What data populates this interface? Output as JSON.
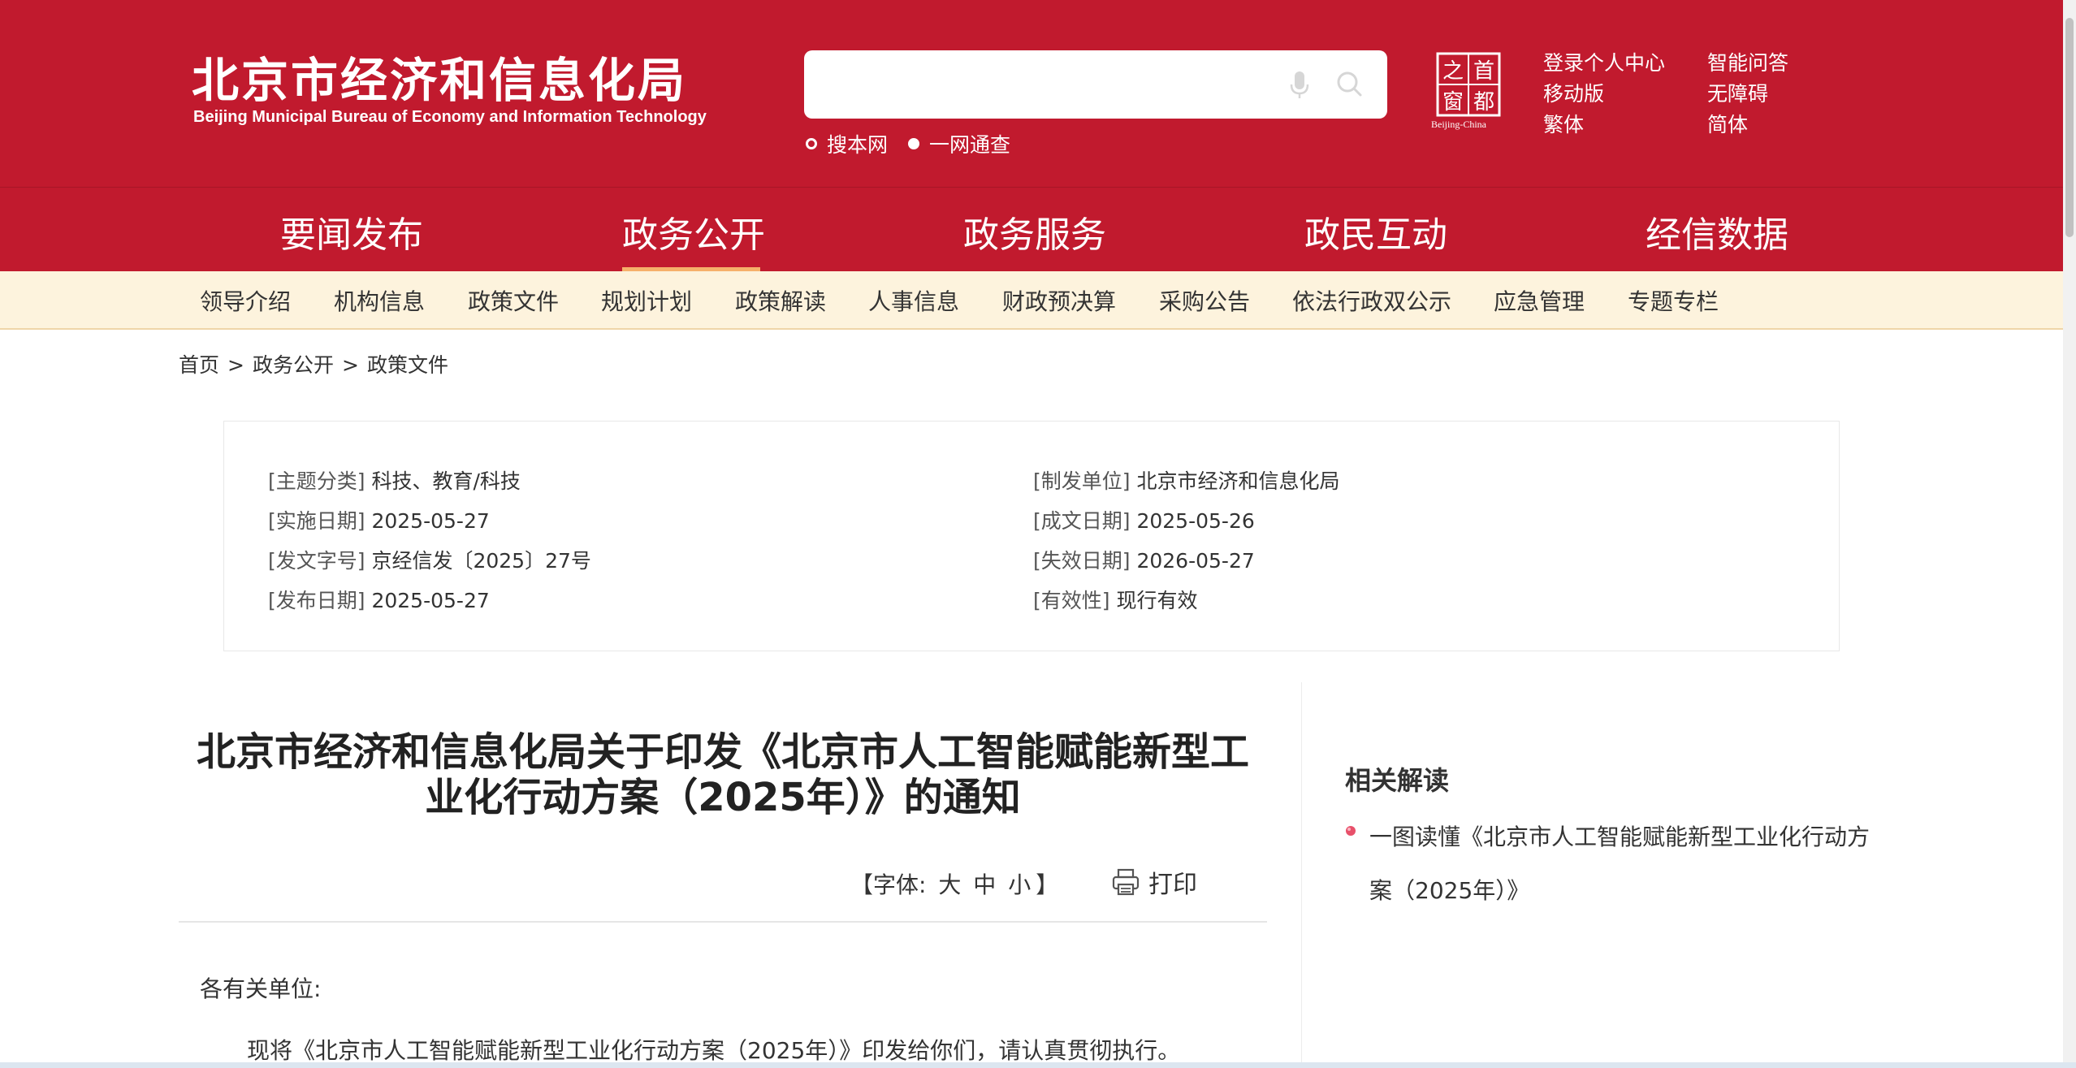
{
  "header": {
    "logo_cn": "北京市经济和信息化局",
    "logo_en": "Beijing Municipal Bureau of Economy and Information Technology",
    "search": {
      "placeholder": ""
    },
    "scope_options": [
      "搜本网",
      "一网通查"
    ],
    "capital_logo": {
      "chars": [
        "之",
        "首",
        "窗",
        "都"
      ],
      "sub": "Beijing-China"
    },
    "links": [
      "登录个人中心",
      "智能问答",
      "移动版",
      "无障碍",
      "繁体",
      "简体"
    ]
  },
  "main_nav": {
    "items": [
      "要闻发布",
      "政务公开",
      "政务服务",
      "政民互动",
      "经信数据"
    ],
    "active": "政务公开"
  },
  "sub_nav": {
    "items": [
      "领导介绍",
      "机构信息",
      "政策文件",
      "规划计划",
      "政策解读",
      "人事信息",
      "财政预决算",
      "采购公告",
      "依法行政双公示",
      "应急管理",
      "专题专栏"
    ]
  },
  "breadcrumb": [
    "首页",
    "政务公开",
    "政策文件"
  ],
  "meta": {
    "left": [
      {
        "label": "[主题分类]",
        "value": "科技、教育/科技"
      },
      {
        "label": "[实施日期]",
        "value": "2025-05-27"
      },
      {
        "label": "[发文字号]",
        "value": "京经信发〔2025〕27号"
      },
      {
        "label": "[发布日期]",
        "value": "2025-05-27"
      }
    ],
    "right": [
      {
        "label": "[制发单位]",
        "value": "北京市经济和信息化局"
      },
      {
        "label": "[成文日期]",
        "value": "2025-05-26"
      },
      {
        "label": "[失效日期]",
        "value": "2026-05-27"
      },
      {
        "label": "[有效性]",
        "value": "现行有效"
      }
    ]
  },
  "article": {
    "title": "北京市经济和信息化局关于印发《北京市人工智能赋能新型工业化行动方案（2025年）》的通知",
    "font_control": {
      "prefix": "【字体:",
      "large": "大",
      "medium": "中",
      "small": "小",
      "suffix": "】"
    },
    "print_label": "打印",
    "salutation": "各有关单位:",
    "paragraph": "现将《北京市人工智能赋能新型工业化行动方案（2025年）》印发给你们，请认真贯彻执行。"
  },
  "related": {
    "title": "相关解读",
    "items": [
      "一图读懂《北京市人工智能赋能新型工业化行动方案（2025年）》"
    ]
  },
  "colors": {
    "brand_red": "#c11a2e",
    "subnav_bg": "#fdf3dd",
    "active_underline": "#f6b06a"
  }
}
